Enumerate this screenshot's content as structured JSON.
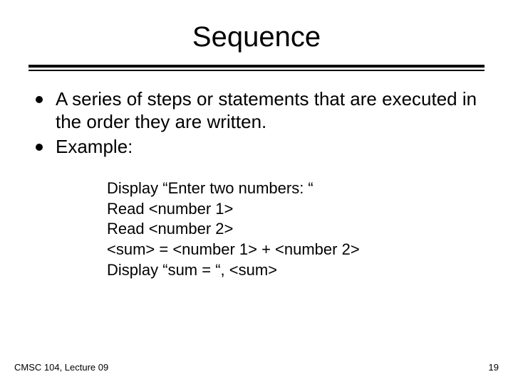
{
  "title": "Sequence",
  "bullets": [
    "A series of steps or statements that are executed in the order they are written.",
    "Example:"
  ],
  "example_lines": [
    "Display “Enter two numbers:  “",
    "Read <number 1>",
    "Read <number 2>",
    "<sum> = <number 1> + <number 2>",
    "Display “sum = “, <sum>"
  ],
  "footer": {
    "left": "CMSC 104, Lecture 09",
    "right": "19"
  }
}
